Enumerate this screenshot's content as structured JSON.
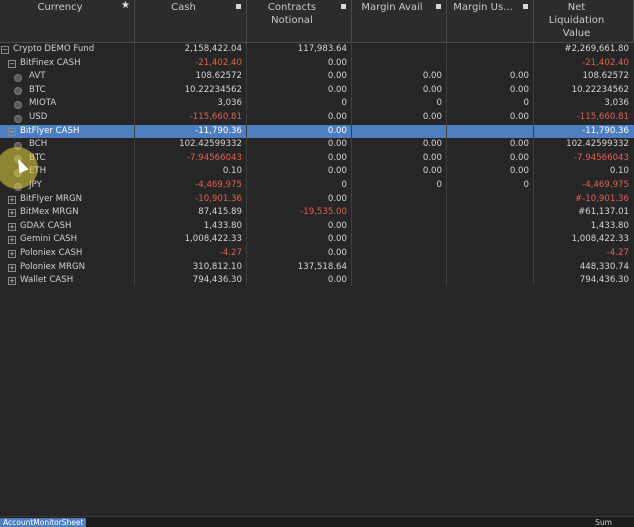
{
  "columns": [
    {
      "key": "currency",
      "label": "Currency",
      "mark": "star"
    },
    {
      "key": "cash",
      "label": "Cash",
      "mark": "square"
    },
    {
      "key": "notional",
      "label": "Contracts\nNotional",
      "mark": "square"
    },
    {
      "key": "margin_avail",
      "label": "Margin Avail",
      "mark": "square"
    },
    {
      "key": "margin_used",
      "label": "Margin Us...",
      "mark": "square"
    },
    {
      "key": "net_liq",
      "label": "Net\nLiquidation Value",
      "mark": "none"
    }
  ],
  "rows": [
    {
      "level": 0,
      "control": "minus",
      "name": "Crypto DEMO Fund",
      "cash": "2,158,422.04",
      "notional": "117,983.64",
      "margin_avail": "",
      "margin_used": "",
      "net_liq": "#2,269,661.80"
    },
    {
      "level": 1,
      "control": "minus",
      "name": "BitFinex CASH",
      "cash": "-21,402.40",
      "notional": "0.00",
      "margin_avail": "",
      "margin_used": "",
      "net_liq": "-21,402.40"
    },
    {
      "level": 2,
      "control": "dot",
      "name": "AVT",
      "cash": "108.62572",
      "notional": "0.00",
      "margin_avail": "0.00",
      "margin_used": "0.00",
      "net_liq": "108.62572"
    },
    {
      "level": 2,
      "control": "dot",
      "name": "BTC",
      "cash": "10.22234562",
      "notional": "0.00",
      "margin_avail": "0.00",
      "margin_used": "0.00",
      "net_liq": "10.22234562"
    },
    {
      "level": 2,
      "control": "dot",
      "name": "MIOTA",
      "cash": "3,036",
      "notional": "0",
      "margin_avail": "0",
      "margin_used": "0",
      "net_liq": "3,036"
    },
    {
      "level": 2,
      "control": "dot",
      "name": "USD",
      "cash": "-115,660.81",
      "notional": "0.00",
      "margin_avail": "0.00",
      "margin_used": "0.00",
      "net_liq": "-115,660.81"
    },
    {
      "level": 1,
      "control": "minus",
      "name": "BitFlyer CASH",
      "cash": "-11,790.36",
      "notional": "0.00",
      "margin_avail": "",
      "margin_used": "",
      "net_liq": "-11,790.36",
      "selected": true
    },
    {
      "level": 2,
      "control": "dot",
      "name": "BCH",
      "cash": "102.42599332",
      "notional": "0.00",
      "margin_avail": "0.00",
      "margin_used": "0.00",
      "net_liq": "102.42599332"
    },
    {
      "level": 2,
      "control": "dot",
      "name": "BTC",
      "cash": "-7.94566043",
      "notional": "0.00",
      "margin_avail": "0.00",
      "margin_used": "0.00",
      "net_liq": "-7.94566043"
    },
    {
      "level": 2,
      "control": "dot",
      "name": "ETH",
      "cash": "0.10",
      "notional": "0.00",
      "margin_avail": "0.00",
      "margin_used": "0.00",
      "net_liq": "0.10"
    },
    {
      "level": 2,
      "control": "dot",
      "name": "JPY",
      "cash": "-4,469,975",
      "notional": "0",
      "margin_avail": "0",
      "margin_used": "0",
      "net_liq": "-4,469,975"
    },
    {
      "level": 1,
      "control": "plus",
      "name": "BitFlyer MRGN",
      "cash": "-10,901.36",
      "notional": "0.00",
      "margin_avail": "",
      "margin_used": "",
      "net_liq": "#-10,901.36"
    },
    {
      "level": 1,
      "control": "plus",
      "name": "BitMex MRGN",
      "cash": "87,415.89",
      "notional": "-19,535.00",
      "margin_avail": "",
      "margin_used": "",
      "net_liq": "#61,137.01"
    },
    {
      "level": 1,
      "control": "plus",
      "name": "GDAX CASH",
      "cash": "1,433.80",
      "notional": "0.00",
      "margin_avail": "",
      "margin_used": "",
      "net_liq": "1,433.80"
    },
    {
      "level": 1,
      "control": "plus",
      "name": "Gemini CASH",
      "cash": "1,008,422.33",
      "notional": "0.00",
      "margin_avail": "",
      "margin_used": "",
      "net_liq": "1,008,422.33"
    },
    {
      "level": 1,
      "control": "plus",
      "name": "Poloniex CASH",
      "cash": "-4.27",
      "notional": "0.00",
      "margin_avail": "",
      "margin_used": "",
      "net_liq": "-4.27"
    },
    {
      "level": 1,
      "control": "plus",
      "name": "Poloniex MRGN",
      "cash": "310,812.10",
      "notional": "137,518.64",
      "margin_avail": "",
      "margin_used": "",
      "net_liq": "448,330.74"
    },
    {
      "level": 1,
      "control": "plus",
      "name": "Wallet CASH",
      "cash": "794,436.30",
      "notional": "0.00",
      "margin_avail": "",
      "margin_used": "",
      "net_liq": "794,436.30"
    }
  ],
  "footer": {
    "tab_label": "AccountMonitorSheet",
    "sum_label": "Sum"
  },
  "colors": {
    "negative": "#e06050",
    "selected_row": "#4d7fc0",
    "background": "#262626"
  }
}
